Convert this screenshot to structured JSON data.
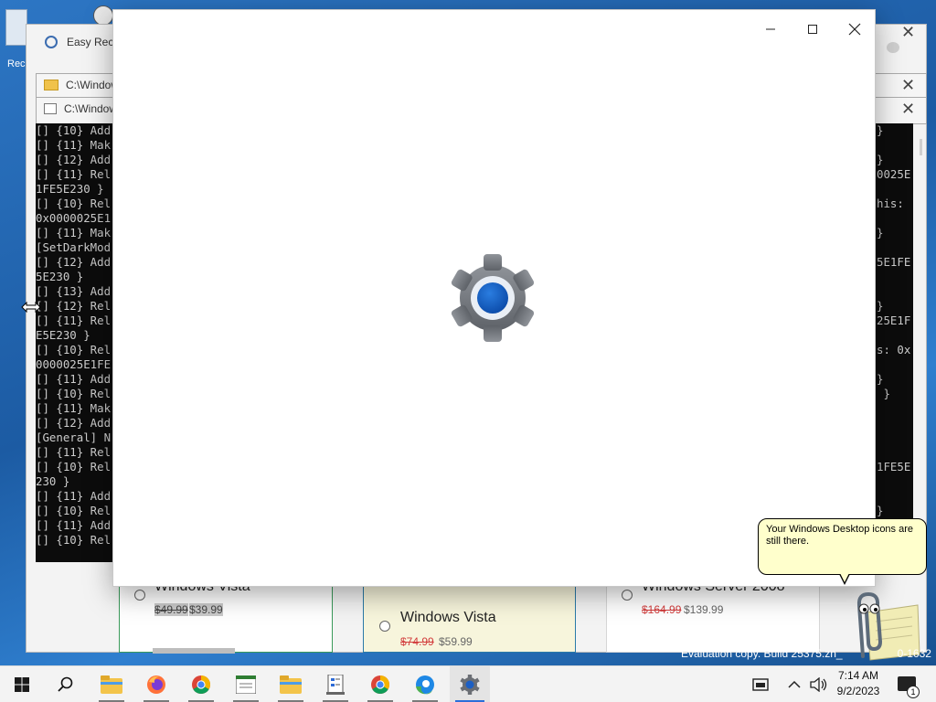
{
  "desktop": {
    "recycle_label": "Rec"
  },
  "easy_recovery_window": {
    "title": "Easy Reco",
    "products": [
      {
        "name": "Windows Vista",
        "old_price": "$49.99",
        "new_price": "$39.99"
      },
      {
        "name": "Windows Vista",
        "old_price": "$74.99",
        "new_price": "$59.99"
      },
      {
        "name": "Windows Server 2008",
        "old_price": "$164.99",
        "new_price": "$139.99"
      }
    ]
  },
  "explorer_window": {
    "title": "C:\\Window"
  },
  "console_window": {
    "title": "C:\\Window",
    "left_lines": [
      "[] {10} Add",
      "[] {11} Mak",
      "[] {12} Add",
      "[] {11} Rel",
      "1FE5E230 }",
      "[] {10} Rel",
      "0x0000025E1",
      "[] {11} Mak",
      "[SetDarkMod",
      "[] {12} Add",
      "5E230 }",
      "[] {13} Add",
      "[] {12} Rel",
      "[] {11} Rel",
      "E5E230 }",
      "[] {10} Rel",
      "0000025E1FE",
      "[] {11} Add",
      "[] {10} Rel",
      "[] {11} Mak",
      "[] {12} Add",
      "[General] N",
      "[] {11} Rel",
      "[] {10} Rel",
      "230 }",
      "[] {11} Add",
      "[] {10} Rel",
      "[] {11} Add",
      "[] {10} Rel"
    ],
    "right_fragments": [
      {
        "row": 0,
        "text": "}"
      },
      {
        "row": 2,
        "text": "}"
      },
      {
        "row": 3,
        "text": "0025E"
      },
      {
        "row": 5,
        "text": "his:"
      },
      {
        "row": 7,
        "text": "}"
      },
      {
        "row": 9,
        "text": "5E1FE"
      },
      {
        "row": 12,
        "text": "}"
      },
      {
        "row": 13,
        "text": "25E1F"
      },
      {
        "row": 15,
        "text": "s: 0x"
      },
      {
        "row": 17,
        "text": "}"
      },
      {
        "row": 18,
        "text": " }"
      },
      {
        "row": 23,
        "text": "1FE5E"
      },
      {
        "row": 26,
        "text": "}"
      }
    ]
  },
  "settings_splash": {
    "minimize_icon": "minimize-icon",
    "maximize_icon": "maximize-icon",
    "close_icon": "close-icon"
  },
  "assistant": {
    "message": "Your Windows Desktop icons are still there."
  },
  "watermark": {
    "text": "Evaluation copy. Build 25375.zn_",
    "suffix": "0-1632"
  },
  "taskbar": {
    "time": "7:14 AM",
    "date": "9/2/2023",
    "notification_count": "1",
    "apps": [
      "start",
      "search",
      "file-explorer",
      "firefox",
      "chrome",
      "notepad-app",
      "file-explorer",
      "registry-app",
      "chrome",
      "edge",
      "settings"
    ]
  },
  "colors": {
    "accent": "#2b6ed9",
    "console_bg": "#0c0c0c",
    "balloon_bg": "#ffffcc",
    "price_old": "#d23b3b"
  }
}
